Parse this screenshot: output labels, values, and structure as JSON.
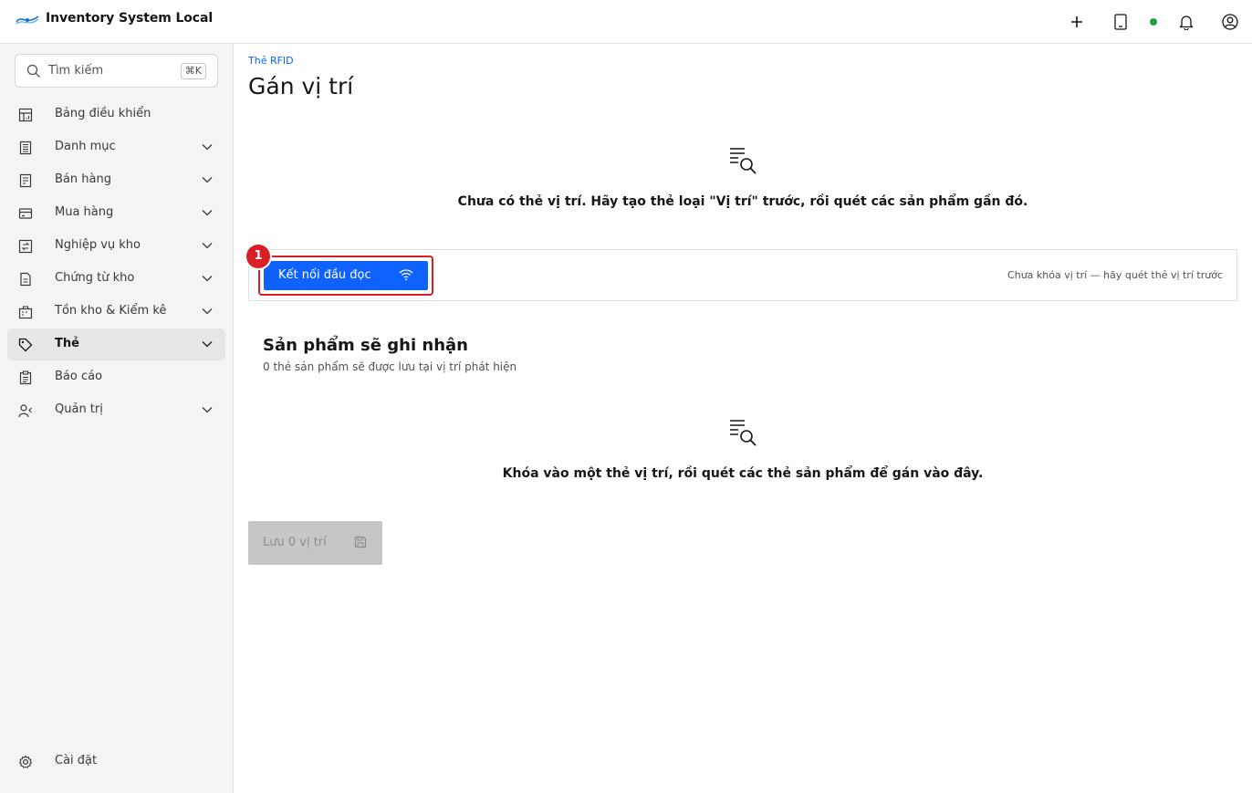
{
  "app": {
    "title": "Inventory System Local"
  },
  "header": {
    "icons": [
      "add-icon",
      "tablet-icon",
      "status-dot",
      "notification-icon",
      "user-avatar-icon"
    ],
    "status_color": "#24a148"
  },
  "sidebar": {
    "search": {
      "placeholder": "Tìm kiếm",
      "shortcut": "⌘K"
    },
    "items": [
      {
        "label": "Bảng điều khiển",
        "icon": "dashboard-icon",
        "has_chevron": false
      },
      {
        "label": "Danh mục",
        "icon": "catalog-icon",
        "has_chevron": true
      },
      {
        "label": "Bán hàng",
        "icon": "sales-icon",
        "has_chevron": true
      },
      {
        "label": "Mua hàng",
        "icon": "purchase-icon",
        "has_chevron": true
      },
      {
        "label": "Nghiệp vụ kho",
        "icon": "warehouse-operations-icon",
        "has_chevron": true
      },
      {
        "label": "Chứng từ kho",
        "icon": "document-icon",
        "has_chevron": true
      },
      {
        "label": "Tồn kho & Kiểm kê",
        "icon": "inventory-icon",
        "has_chevron": true
      },
      {
        "label": "Thẻ",
        "icon": "tag-icon",
        "has_chevron": true,
        "active": true
      },
      {
        "label": "Báo cáo",
        "icon": "report-icon",
        "has_chevron": false
      },
      {
        "label": "Quản trị",
        "icon": "admin-icon",
        "has_chevron": true
      }
    ],
    "settings": {
      "label": "Cài đặt",
      "icon": "settings-icon"
    }
  },
  "main": {
    "breadcrumb": "Thẻ RFID",
    "title": "Gán vị trí",
    "empty_locations": "Chưa có thẻ vị trí. Hãy tạo thẻ loại \"Vị trí\" trước, rồi quét các sản phẩm gần đó.",
    "toolbar": {
      "connect_label": "Kết nối đầu đọc",
      "step_number": "1",
      "status": "Chưa khóa vị trí — hãy quét thẻ vị trí trước"
    },
    "products": {
      "title": "Sản phẩm sẽ ghi nhận",
      "subtitle": "0 thẻ sản phẩm sẽ được lưu tại vị trí phát hiện",
      "empty": "Khóa vào một thẻ vị trí, rồi quét các thẻ sản phẩm để gán vào đây."
    },
    "save_label": "Lưu 0 vị trí"
  },
  "colors": {
    "primary": "#0f62fe",
    "highlight": "#da1e28",
    "disabled": "#c6c6c6"
  }
}
